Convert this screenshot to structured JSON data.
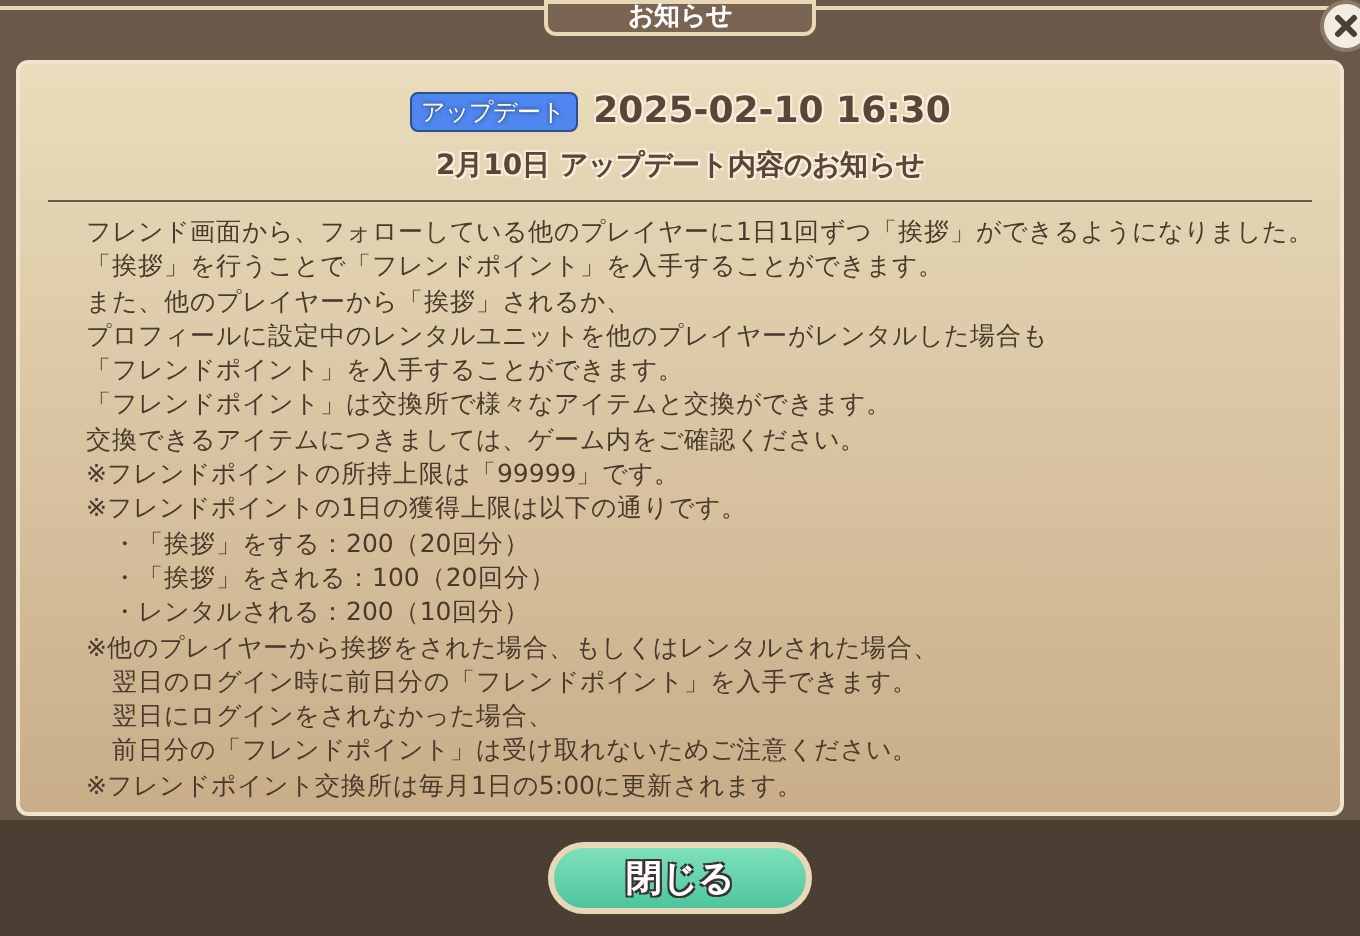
{
  "window": {
    "title": "お知らせ"
  },
  "notice": {
    "tag": "アップデート",
    "datetime": "2025-02-10 16:30",
    "heading": "2月10日 アップデート内容のお知らせ",
    "lines": [
      {
        "kind": "text",
        "text": "フレンド画面から、フォローしている他のプレイヤーに1日1回ずつ「挨拶」ができるようになりました。"
      },
      {
        "kind": "text",
        "text": "「挨拶」を行うことで「フレンドポイント」を入手することができます。"
      },
      {
        "kind": "text",
        "text": "また、他のプレイヤーから「挨拶」されるか、"
      },
      {
        "kind": "text",
        "text": "プロフィールに設定中のレンタルユニットを他のプレイヤーがレンタルした場合も"
      },
      {
        "kind": "text",
        "text": "「フレンドポイント」を入手することができます。"
      },
      {
        "kind": "text",
        "text": "「フレンドポイント」は交換所で様々なアイテムと交換ができます。"
      },
      {
        "kind": "text",
        "text": "交換できるアイテムにつきましては、ゲーム内をご確認ください。"
      },
      {
        "kind": "text",
        "text": "※フレンドポイントの所持上限は「99999」です。"
      },
      {
        "kind": "text",
        "text": "※フレンドポイントの1日の獲得上限は以下の通りです。"
      },
      {
        "kind": "indent",
        "text": "・「挨拶」をする：200（20回分）"
      },
      {
        "kind": "indent",
        "text": "・「挨拶」をされる：100（20回分）"
      },
      {
        "kind": "indent",
        "text": "・レンタルされる：200（10回分）"
      },
      {
        "kind": "text",
        "text": "※他のプレイヤーから挨拶をされた場合、もしくはレンタルされた場合、"
      },
      {
        "kind": "indent",
        "text": "翌日のログイン時に前日分の「フレンドポイント」を入手できます。"
      },
      {
        "kind": "indent",
        "text": "翌日にログインをされなかった場合、"
      },
      {
        "kind": "indent",
        "text": "前日分の「フレンドポイント」は受け取れないためご注意ください。"
      },
      {
        "kind": "text",
        "text": "※フレンドポイント交換所は毎月1日の5:00に更新されます。"
      }
    ]
  },
  "buttons": [
    "閉じる"
  ]
}
